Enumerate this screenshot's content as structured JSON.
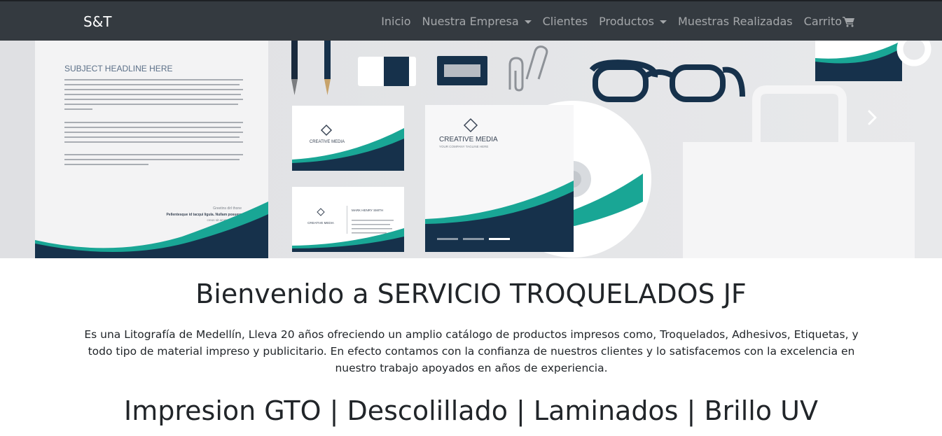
{
  "navbar": {
    "brand": "S&T",
    "items": [
      {
        "label": "Inicio",
        "dropdown": false
      },
      {
        "label": "Nuestra Empresa",
        "dropdown": true
      },
      {
        "label": "Clientes",
        "dropdown": false
      },
      {
        "label": "Productos",
        "dropdown": true
      },
      {
        "label": "Muestras Realizadas",
        "dropdown": false
      },
      {
        "label": "Carrito",
        "dropdown": false,
        "icon": "shopping-cart-icon"
      }
    ],
    "colors": {
      "background": "#343a40",
      "text": "rgba(255,255,255,0.55)"
    }
  },
  "carousel": {
    "slide_count": 3,
    "active_slide": 3,
    "letterhead": {
      "headline": "SUBJECT HEADLINE HERE",
      "signature_name": "Greetins dirl thone",
      "signature_line": "Pellentesque id tacqui ligula. Nullam posuere",
      "signature_small": "creos sit ametur nostrum"
    },
    "brand_text": "CREATIVE MEDIA",
    "brand_tagline": "YOUR COMPANY TAGLINE HERE",
    "card_name": "MARK HENRY SMITH",
    "colors": {
      "accent_teal": "#19a695",
      "accent_navy": "#16314b"
    }
  },
  "main": {
    "title": "Bienvenido a SERVICIO TROQUELADOS JF",
    "description": "Es una Litografía de Medellín, Lleva 20 años ofreciendo un amplio catálogo de productos impresos como, Troquelados, Adhesivos, Etiquetas, y todo tipo de material impreso y publicitario. En efecto contamos con la confianza de nuestros clientes y lo satisfacemos con la excelencia en nuestro trabajo apoyados en años de experiencia.",
    "services": "Impresion GTO | Descolillado | Laminados | Brillo UV"
  }
}
